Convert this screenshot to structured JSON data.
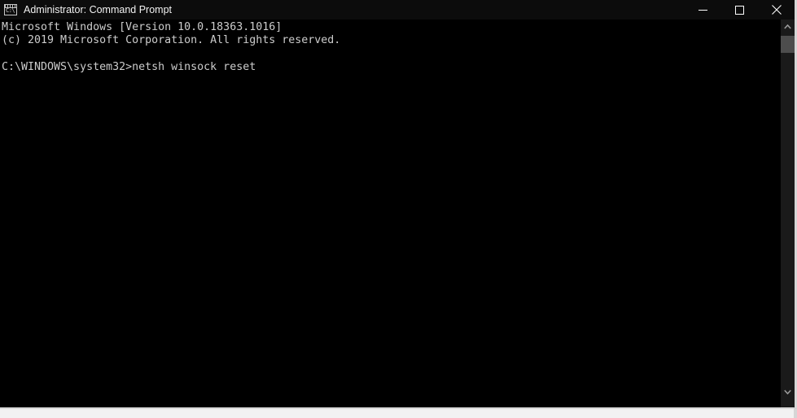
{
  "window": {
    "title": "Administrator: Command Prompt",
    "icon": "console-icon",
    "icon_prompt_glyph": "C:\\",
    "background_color": "#000000",
    "titlebar_color": "#0c0c0c",
    "text_color": "#cccccc",
    "controls": {
      "minimize": "Minimize",
      "maximize": "Maximize",
      "close": "Close"
    }
  },
  "console": {
    "lines": [
      "Microsoft Windows [Version 10.0.18363.1016]",
      "(c) 2019 Microsoft Corporation. All rights reserved.",
      "",
      "C:\\WINDOWS\\system32>netsh winsock reset"
    ],
    "text": "Microsoft Windows [Version 10.0.18363.1016]\n(c) 2019 Microsoft Corporation. All rights reserved.\n\nC:\\WINDOWS\\system32>netsh winsock reset",
    "os_name": "Microsoft Windows",
    "os_version": "10.0.18363.1016",
    "copyright": "(c) 2019 Microsoft Corporation. All rights reserved.",
    "prompt_path": "C:\\WINDOWS\\system32>",
    "command": "netsh winsock reset"
  },
  "scrollbar": {
    "up_arrow": "scroll-up-arrow",
    "down_arrow": "scroll-down-arrow",
    "thumb": "scroll-thumb",
    "track_color": "#1a1a1a",
    "thumb_color": "#4d4d4d"
  },
  "background": {
    "bottom_text": "",
    "accent_color": "#8d2231"
  }
}
